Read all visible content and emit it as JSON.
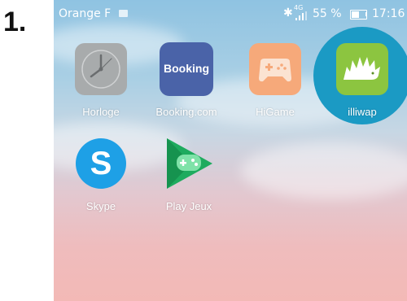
{
  "step_number": "1.",
  "status_bar": {
    "carrier": "Orange F",
    "network": "4G",
    "battery_percent": "55 %",
    "battery_level": 0.55,
    "time": "17:16"
  },
  "apps": [
    {
      "label": "Horloge",
      "icon": "clock-icon"
    },
    {
      "label": "Booking.com",
      "icon": "booking-icon",
      "icon_text": "Booking"
    },
    {
      "label": "HiGame",
      "icon": "gamepad-icon"
    },
    {
      "label": "illiwap",
      "icon": "hedgehog-icon",
      "highlighted": true
    },
    {
      "label": "Skype",
      "icon": "skype-icon"
    },
    {
      "label": "Play Jeux",
      "icon": "play-games-icon"
    }
  ],
  "colors": {
    "highlight": "#1b9ac4",
    "booking": "#4a63a8",
    "higame": "#f6a97a",
    "illiwap": "#8cc540",
    "skype": "#1ea0e6",
    "play_jeux": "#1eab5e"
  }
}
